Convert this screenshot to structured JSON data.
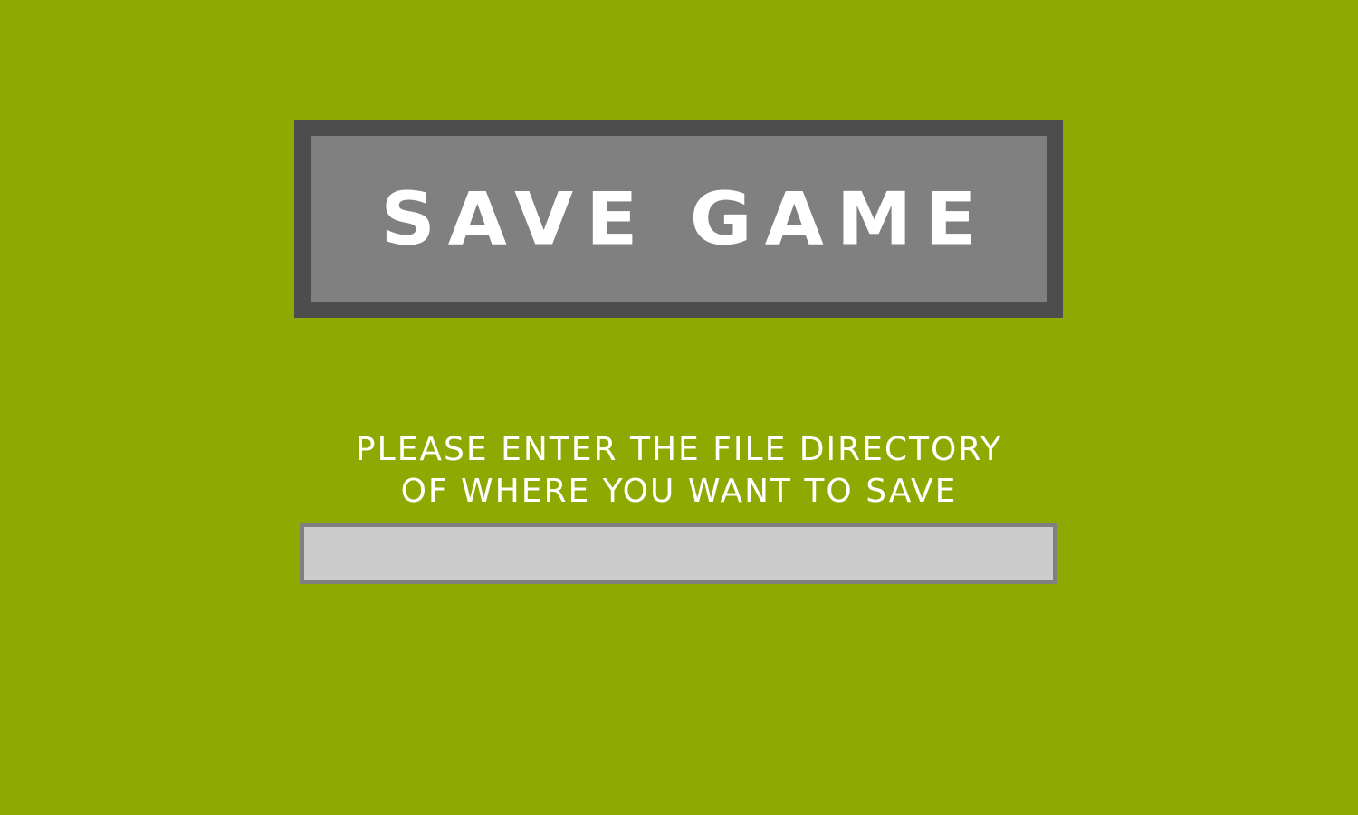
{
  "title": "SAVE GAME",
  "prompt": {
    "line1": "PLEASE ENTER THE FILE DIRECTORY",
    "line2": "OF WHERE YOU WANT TO SAVE"
  },
  "directory_input": {
    "value": "",
    "placeholder": ""
  },
  "colors": {
    "background": "#8da902",
    "panel_fill": "#808080",
    "panel_border": "#4d4d4d",
    "input_fill": "#cccccc",
    "input_border": "#808080",
    "text": "#ffffff"
  }
}
